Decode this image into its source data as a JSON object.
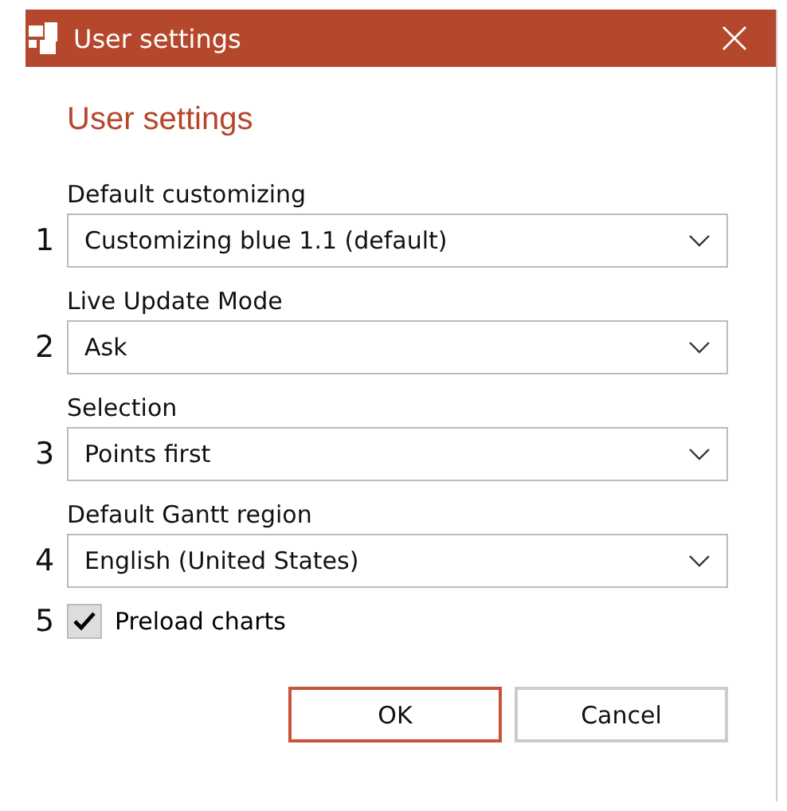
{
  "window": {
    "title": "User settings"
  },
  "heading": "User settings",
  "fields": [
    {
      "number": "1",
      "kind": "dropdown",
      "label": "Default customizing",
      "value": "Customizing blue 1.1 (default)"
    },
    {
      "number": "2",
      "kind": "dropdown",
      "label": "Live Update Mode",
      "value": "Ask"
    },
    {
      "number": "3",
      "kind": "dropdown",
      "label": "Selection",
      "value": "Points first"
    },
    {
      "number": "4",
      "kind": "dropdown",
      "label": "Default Gantt region",
      "value": "English (United States)"
    },
    {
      "number": "5",
      "kind": "checkbox",
      "label": "Preload charts",
      "checked": true
    }
  ],
  "buttons": [
    {
      "label": "OK",
      "default": true
    },
    {
      "label": "Cancel",
      "default": false
    }
  ]
}
